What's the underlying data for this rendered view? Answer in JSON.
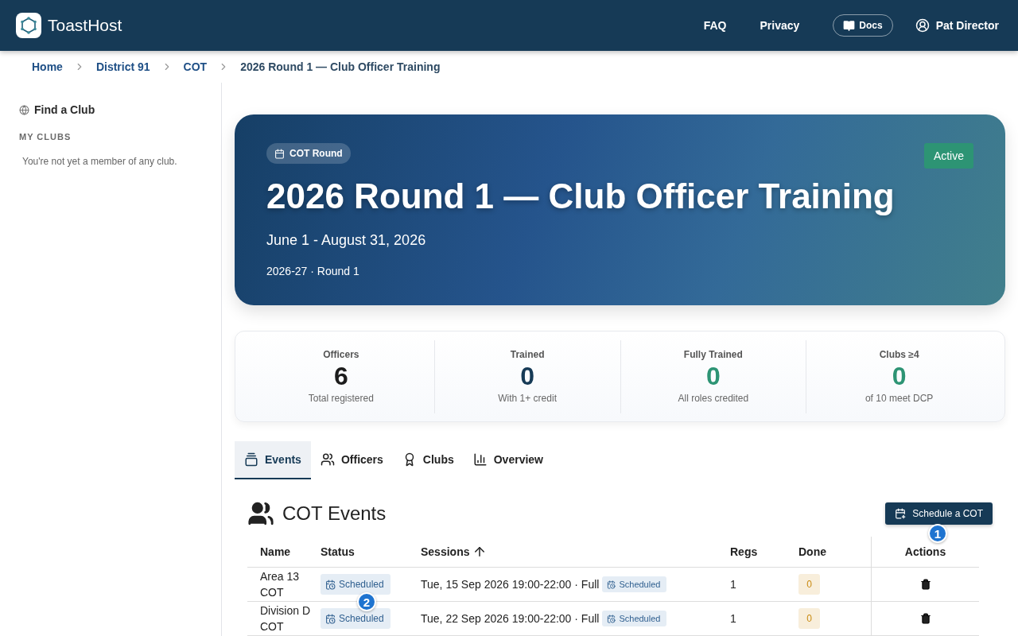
{
  "app": {
    "name": "ToastHost"
  },
  "nav": {
    "links": [
      "FAQ",
      "Privacy"
    ],
    "docs": "Docs",
    "user": "Pat Director"
  },
  "breadcrumb": {
    "links": [
      "Home",
      "District 91",
      "COT"
    ],
    "current": "2026 Round 1 — Club Officer Training"
  },
  "sidebar": {
    "find": "Find a Club",
    "section": "MY CLUBS",
    "empty": "You're not yet a member of any club."
  },
  "hero": {
    "tag": "COT Round",
    "status": "Active",
    "title": "2026 Round 1 — Club Officer Training",
    "dates": "June 1 - August 31, 2026",
    "meta": "2026-27 · Round 1"
  },
  "stats": [
    {
      "label": "Officers",
      "value": "6",
      "sub": "Total registered",
      "color": "#1c1c1c"
    },
    {
      "label": "Trained",
      "value": "0",
      "sub": "With 1+ credit",
      "color": "#163a56"
    },
    {
      "label": "Fully Trained",
      "value": "0",
      "sub": "All roles credited",
      "color": "#2d9474"
    },
    {
      "label": "Clubs ≥4",
      "value": "0",
      "sub": "of 10 meet DCP",
      "color": "#2d9474"
    }
  ],
  "tabs": [
    {
      "label": "Events",
      "selected": true
    },
    {
      "label": "Officers",
      "selected": false
    },
    {
      "label": "Clubs",
      "selected": false
    },
    {
      "label": "Overview",
      "selected": false
    }
  ],
  "events": {
    "title": "COT Events",
    "action": "Schedule a COT",
    "columns": [
      "Name",
      "Status",
      "Sessions",
      "Regs",
      "Done",
      "Actions"
    ],
    "rows": [
      {
        "name": "Area 13 COT",
        "status": "Scheduled",
        "session": "Tue, 15 Sep 2026 19:00-22:00 · Full",
        "session_status": "Scheduled",
        "regs": "1",
        "done": "0"
      },
      {
        "name": "Division D COT",
        "status": "Scheduled",
        "session": "Tue, 22 Sep 2026 19:00-22:00 · Full",
        "session_status": "Scheduled",
        "regs": "1",
        "done": "0"
      }
    ]
  },
  "markers": [
    {
      "label": "1"
    },
    {
      "label": "2"
    }
  ]
}
